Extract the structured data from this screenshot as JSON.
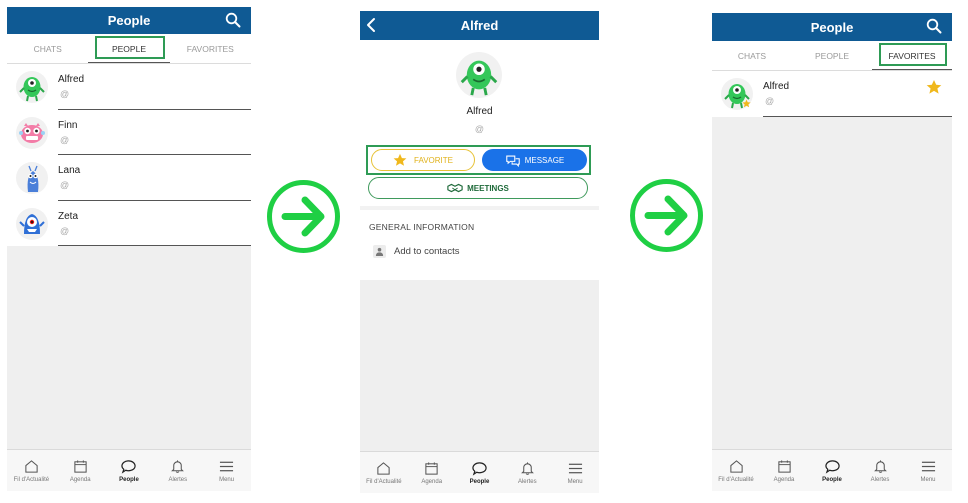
{
  "colors": {
    "header": "#0f5a94",
    "annotation_green": "#2e9b55",
    "arrow_green": "#1fcf44",
    "favorite_yellow": "#e0b21b",
    "message_blue": "#1a72e8"
  },
  "screen1": {
    "title": "People",
    "tabs": [
      "CHATS",
      "PEOPLE",
      "FAVORITES"
    ],
    "active_tab": "PEOPLE",
    "contacts": [
      {
        "name": "Alfred",
        "handle": "@",
        "avatar": "green-monster-avatar"
      },
      {
        "name": "Finn",
        "handle": "@",
        "avatar": "pink-monster-avatar"
      },
      {
        "name": "Lana",
        "handle": "@",
        "avatar": "blue-monster-avatar"
      },
      {
        "name": "Zeta",
        "handle": "@",
        "avatar": "blue-cyclops-avatar"
      }
    ]
  },
  "screen2": {
    "title": "Alfred",
    "profile_name": "Alfred",
    "profile_handle": "@",
    "favorite_label": "FAVORITE",
    "message_label": "MESSAGE",
    "meetings_label": "MEETINGS",
    "section_heading": "GENERAL INFORMATION",
    "add_to_contacts": "Add to contacts"
  },
  "screen3": {
    "title": "People",
    "tabs": [
      "CHATS",
      "PEOPLE",
      "FAVORITES"
    ],
    "active_tab": "FAVORITES",
    "contacts": [
      {
        "name": "Alfred",
        "handle": "@",
        "favorite": true
      }
    ]
  },
  "bottom_nav": [
    {
      "label": "Fil d'Actualité",
      "icon": "home-icon"
    },
    {
      "label": "Agenda",
      "icon": "calendar-icon"
    },
    {
      "label": "People",
      "icon": "chat-bubble-icon",
      "active": true
    },
    {
      "label": "Alertes",
      "icon": "bell-icon"
    },
    {
      "label": "Menu",
      "icon": "hamburger-icon"
    }
  ]
}
